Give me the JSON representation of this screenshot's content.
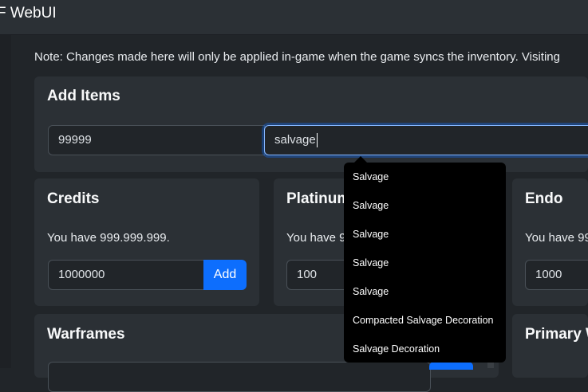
{
  "app": {
    "title": "F WebUI"
  },
  "note": "Note: Changes made here will only be applied in-game when the game syncs the inventory. Visiting",
  "add_items": {
    "title": "Add Items",
    "quantity_value": "99999",
    "search_value": "salvage"
  },
  "autocomplete": {
    "items": [
      "Salvage",
      "Salvage",
      "Salvage",
      "Salvage",
      "Salvage",
      "Compacted Salvage Decoration",
      "Salvage Decoration"
    ]
  },
  "credits": {
    "title": "Credits",
    "text": "You have 999.999.999.",
    "input_value": "1000000",
    "add_label": "Add"
  },
  "platinum": {
    "title": "Platinum",
    "text": "You have 9",
    "input_value": "100"
  },
  "endo": {
    "title": "Endo",
    "text": "You have 99",
    "input_value": "1000"
  },
  "warframes": {
    "title": "Warframes"
  },
  "primary": {
    "title": "Primary W"
  },
  "colors": {
    "background": "#212529",
    "card": "#2b3035",
    "accent": "#0d6efd",
    "dropdown": "#000000"
  }
}
